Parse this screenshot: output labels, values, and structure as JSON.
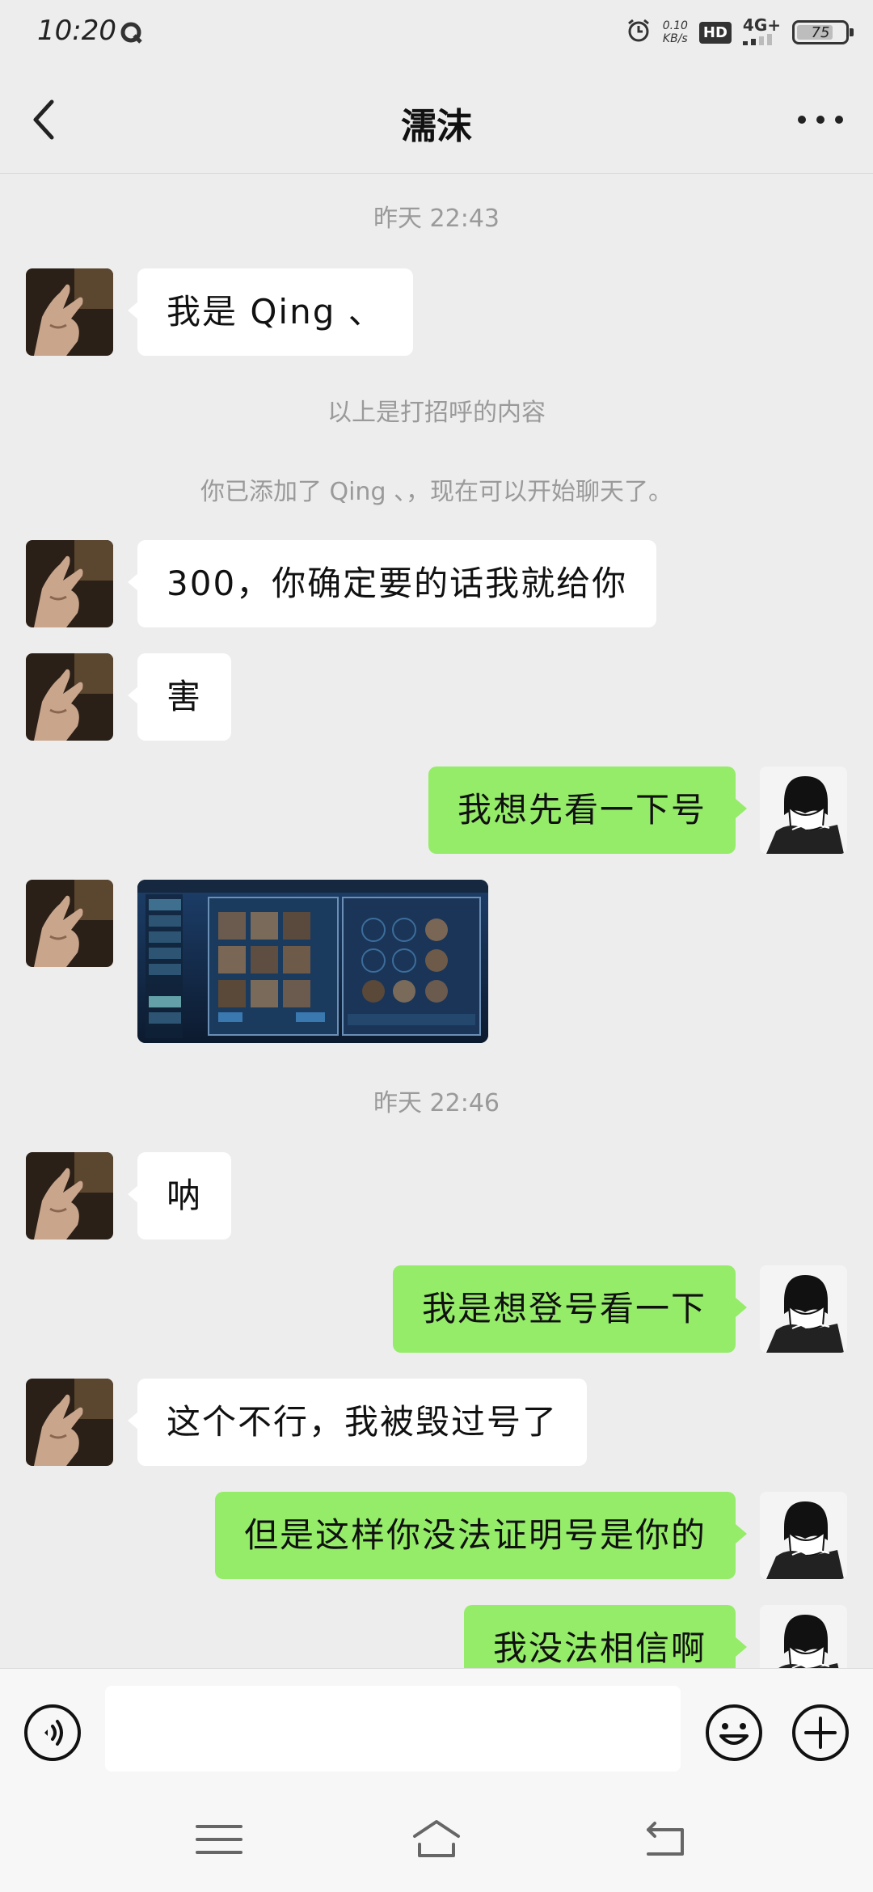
{
  "status_bar": {
    "time": "10:20",
    "speed_value": "0.10",
    "speed_unit": "KB/s",
    "hd_label": "HD",
    "network": "4G+",
    "battery": "75",
    "battery_level": 0.75
  },
  "header": {
    "title": "濡沫"
  },
  "chat": {
    "timestamps": [
      "昨天 22:43",
      "昨天 22:46"
    ],
    "system_messages": [
      "以上是打招呼的内容",
      "你已添加了 Qing 、，现在可以开始聊天了。"
    ],
    "messages": [
      {
        "side": "in",
        "type": "text",
        "text": "我是 Qing 、"
      },
      {
        "side": "in",
        "type": "text",
        "text": "300，你确定要的话我就给你"
      },
      {
        "side": "in",
        "type": "text",
        "text": "害"
      },
      {
        "side": "out",
        "type": "text",
        "text": "我想先看一下号"
      },
      {
        "side": "in",
        "type": "image"
      },
      {
        "side": "in",
        "type": "text",
        "text": "呐"
      },
      {
        "side": "out",
        "type": "text",
        "text": "我是想登号看一下"
      },
      {
        "side": "in",
        "type": "text",
        "text": "这个不行，我被毁过号了"
      },
      {
        "side": "out",
        "type": "text",
        "text": "但是这样你没法证明号是你的"
      },
      {
        "side": "out",
        "type": "text",
        "text": "我没法相信啊"
      }
    ]
  },
  "input_bar": {
    "value": "",
    "placeholder": ""
  },
  "icons": {
    "back": "chevron-left-icon",
    "more": "more-dots-icon",
    "voice": "voice-icon",
    "emoji": "emoji-icon",
    "plus": "plus-icon",
    "nav_menu": "menu-icon",
    "nav_home": "home-icon",
    "nav_back": "back-nav-icon"
  },
  "colors": {
    "background": "#ededed",
    "bubble_out": "#95ec69",
    "bubble_in": "#ffffff",
    "system_text": "#9a9a9a"
  }
}
